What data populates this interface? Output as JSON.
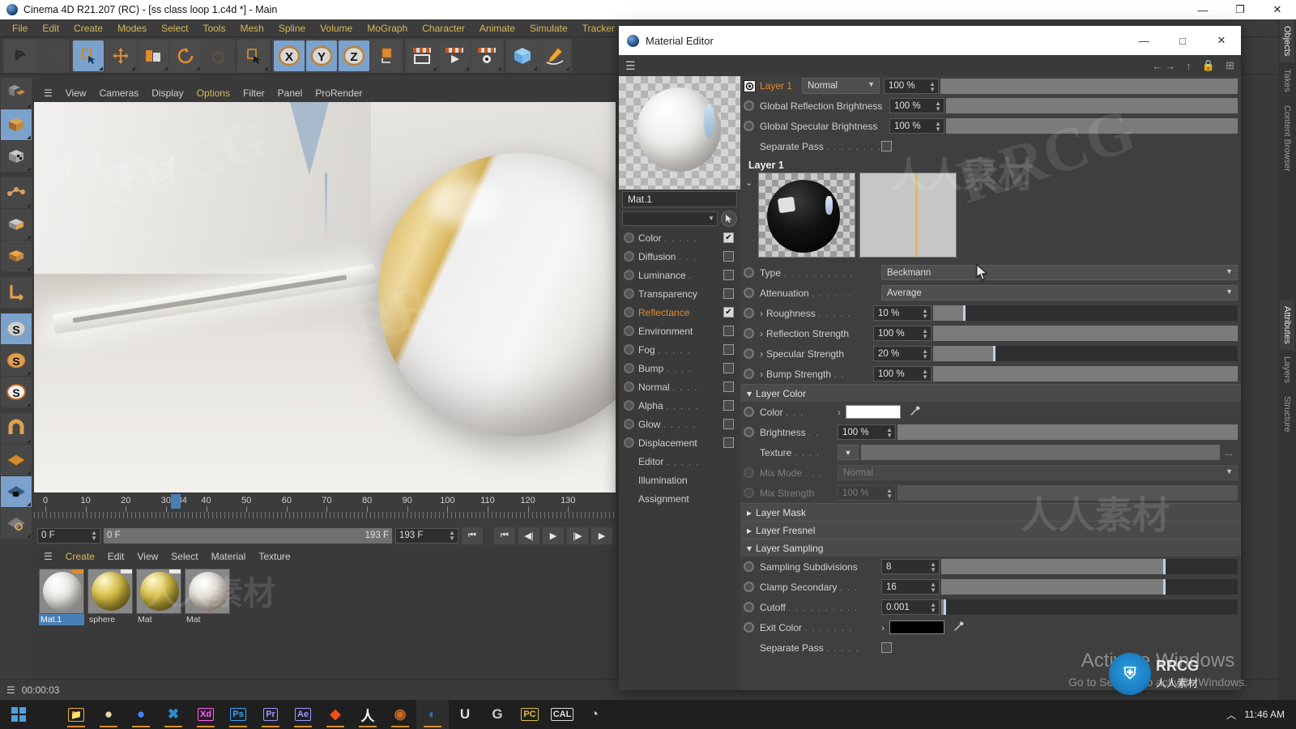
{
  "window": {
    "title": "Cinema 4D R21.207 (RC) - [ss class loop 1.c4d *] - Main",
    "minimize": "—",
    "restore": "❐",
    "close": "✕"
  },
  "menubar": [
    "File",
    "Edit",
    "Create",
    "Modes",
    "Select",
    "Tools",
    "Mesh",
    "Spline",
    "Volume",
    "MoGraph",
    "Character",
    "Animate",
    "Simulate",
    "Tracker"
  ],
  "toolbar_icons": [
    {
      "name": "undo-icon",
      "glyph": "↺"
    },
    {
      "name": "redo-icon",
      "glyph": "↻"
    },
    {
      "name": "select-tool-icon",
      "glyph": "▣"
    },
    {
      "name": "move-tool-icon",
      "glyph": "✛"
    },
    {
      "name": "scale-tool-icon",
      "glyph": "▤"
    },
    {
      "name": "rotate-tool-icon",
      "glyph": "⟳"
    },
    {
      "name": "rotate-disabled-icon",
      "glyph": "⭕"
    },
    {
      "name": "world-object-axis-icon",
      "glyph": "▢"
    },
    {
      "name": "axis-x-icon",
      "glyph": "X"
    },
    {
      "name": "axis-y-icon",
      "glyph": "Y"
    },
    {
      "name": "axis-z-icon",
      "glyph": "Z"
    },
    {
      "name": "world-coordinate-icon",
      "glyph": "⬛"
    },
    {
      "name": "render-view-icon",
      "glyph": "▭"
    },
    {
      "name": "render-to-picture-viewer-icon",
      "glyph": "▶"
    },
    {
      "name": "render-settings-icon",
      "glyph": "⚙"
    },
    {
      "name": "cube-primitive-icon",
      "glyph": "⬛"
    },
    {
      "name": "spline-pen-icon",
      "glyph": "✎"
    }
  ],
  "left_toolbar": [
    {
      "name": "make-editable-icon",
      "glyph": "⬓"
    },
    {
      "name": "model-mode-icon",
      "glyph": "▥"
    },
    {
      "name": "texture-mode-icon",
      "glyph": "▦"
    },
    {
      "name": "point-mode-icon",
      "glyph": "⬡"
    },
    {
      "name": "edge-mode-icon",
      "glyph": "▤"
    },
    {
      "name": "polygon-mode-icon",
      "glyph": "▧"
    },
    {
      "name": "axis-modify-icon",
      "glyph": "∟"
    },
    {
      "name": "enable-axis-icon",
      "glyph": "S"
    },
    {
      "name": "enable-snap-icon",
      "glyph": "S"
    },
    {
      "name": "workplane-icon",
      "glyph": "S"
    },
    {
      "name": "magnet-icon",
      "glyph": "U"
    },
    {
      "name": "grid-icon",
      "glyph": "◈"
    },
    {
      "name": "workplane-lock-icon",
      "glyph": "◈"
    },
    {
      "name": "workplane-rotate-icon",
      "glyph": "◈"
    }
  ],
  "viewport": {
    "menu": [
      "View",
      "Cameras",
      "Display",
      "Options",
      "Filter",
      "Panel",
      "ProRender"
    ],
    "highlight": "Options"
  },
  "timeline": {
    "labels": [
      "0",
      "10",
      "20",
      "30",
      "34",
      "40",
      "50",
      "60",
      "70",
      "80",
      "90",
      "100",
      "110",
      "120",
      "130"
    ],
    "current_frame_label": "34",
    "start_field": "0 F",
    "range_left": "0 F",
    "range_right": "193 F",
    "end_field": "193 F",
    "transport": [
      "⏮",
      "⏮",
      "◀|",
      "▶",
      "|▶",
      "▶"
    ]
  },
  "material_manager": {
    "menu": [
      "Create",
      "Edit",
      "View",
      "Select",
      "Material",
      "Texture"
    ],
    "highlight": "Create",
    "materials": [
      {
        "name": "Mat.1",
        "selected": true,
        "tag": "orange"
      },
      {
        "name": "sphere",
        "selected": false,
        "tag": "white"
      },
      {
        "name": "Mat",
        "selected": false,
        "tag": "white"
      },
      {
        "name": "Mat",
        "selected": false,
        "tag": "none"
      }
    ]
  },
  "statusbar": {
    "time": "00:00:03"
  },
  "right_tabs": [
    {
      "label": "Objects",
      "active": true
    },
    {
      "label": "Takes",
      "active": false
    },
    {
      "label": "Content Browser",
      "active": false
    },
    {
      "label": "Attributes",
      "active": true
    },
    {
      "label": "Layers",
      "active": false
    },
    {
      "label": "Structure",
      "active": false
    }
  ],
  "material_editor": {
    "title": "Material Editor",
    "window_controls": {
      "minimize": "—",
      "maximize": "□",
      "close": "✕"
    },
    "nav_icons": [
      "←",
      "→",
      "↑",
      "🔒",
      "⊞"
    ],
    "material_name": "Mat.1",
    "channels": [
      {
        "label": "Color",
        "dots": ". . . . .",
        "checked": true,
        "active": false
      },
      {
        "label": "Diffusion",
        "dots": ". . .",
        "checked": false,
        "active": false
      },
      {
        "label": "Luminance",
        "dots": ".",
        "checked": false,
        "active": false
      },
      {
        "label": "Transparency",
        "dots": "",
        "checked": false,
        "active": false
      },
      {
        "label": "Reflectance",
        "dots": "",
        "checked": true,
        "active": true
      },
      {
        "label": "Environment",
        "dots": "",
        "checked": false,
        "active": false
      },
      {
        "label": "Fog",
        "dots": ". . . . .",
        "checked": false,
        "active": false
      },
      {
        "label": "Bump",
        "dots": ". . . .",
        "checked": false,
        "active": false
      },
      {
        "label": "Normal",
        "dots": ". . . .",
        "checked": false,
        "active": false
      },
      {
        "label": "Alpha",
        "dots": ". . . . .",
        "checked": false,
        "active": false
      },
      {
        "label": "Glow",
        "dots": ". . . . .",
        "checked": false,
        "active": false
      },
      {
        "label": "Displacement",
        "dots": "",
        "checked": false,
        "active": false
      }
    ],
    "sub_items": [
      {
        "label": "Editor",
        "dots": ". . . . ."
      },
      {
        "label": "Illumination",
        "dots": ""
      },
      {
        "label": "Assignment",
        "dots": ""
      }
    ],
    "layer_header": {
      "name": "Layer 1",
      "blend_mode": "Normal",
      "opacity": "100 %"
    },
    "globals": [
      {
        "label": "Global Reflection Brightness",
        "value": "100 %",
        "fill": 100
      },
      {
        "label": "Global Specular Brightness",
        "value": "100 %",
        "fill": 100
      }
    ],
    "separate_pass_top": {
      "label": "Separate Pass",
      "dots": ". . . . . . . . ."
    },
    "layer_section": {
      "title": "Layer 1"
    },
    "type_row": {
      "label": "Type",
      "dots": ". . . . . . . . . .",
      "value": "Beckmann"
    },
    "attenuation_row": {
      "label": "Attenuation",
      "dots": ". . . . . .",
      "value": "Average"
    },
    "params": [
      {
        "label": "Roughness",
        "dots": ". . . . .",
        "value": "10 %",
        "fill": 10,
        "arrow": "›"
      },
      {
        "label": "Reflection Strength",
        "dots": "",
        "value": "100 %",
        "fill": 100,
        "arrow": "›"
      },
      {
        "label": "Specular Strength",
        "dots": "",
        "value": "20 %",
        "fill": 20,
        "arrow": "›"
      },
      {
        "label": "Bump Strength",
        "dots": ". .",
        "value": "100 %",
        "fill": 100,
        "arrow": "›"
      }
    ],
    "layer_color": {
      "title": "Layer Color",
      "color_label": "Color",
      "color_dots": ". . .",
      "color_hex": "#ffffff",
      "brightness_label": "Brightness",
      "brightness_dots": ". .",
      "brightness_value": "100 %",
      "brightness_fill": 100,
      "texture_label": "Texture",
      "texture_dots": ". . . .",
      "texture_value": "",
      "texture_more": "...",
      "mix_mode_label": "Mix Mode",
      "mix_mode_dots": ". . .",
      "mix_mode_value": "Normal",
      "mix_strength_label": "Mix Strength",
      "mix_strength_dots": "",
      "mix_strength_value": "100 %"
    },
    "collapsed_sections": [
      {
        "title": "Layer Mask",
        "arrow": "▸"
      },
      {
        "title": "Layer Fresnel",
        "arrow": "▸"
      }
    ],
    "layer_sampling": {
      "title": "Layer Sampling",
      "rows": [
        {
          "label": "Sampling Subdivisions",
          "dots": "",
          "value": "8",
          "fill": 75
        },
        {
          "label": "Clamp Secondary",
          "dots": ". . .",
          "value": "16",
          "fill": 75
        },
        {
          "label": "Cutoff",
          "dots": ". . . . . . . . . .",
          "value": "0.001",
          "fill": 1
        }
      ],
      "exit_color": {
        "label": "Exit Color",
        "dots": ". . . . . . .",
        "hex": "#000000"
      },
      "separate_pass": {
        "label": "Separate Pass",
        "dots": ". . . . ."
      }
    }
  },
  "activate_windows": {
    "line1": "Activate Windows",
    "line2": "Go to Settings to activate Windows."
  },
  "taskbar": {
    "start_icon": "⊞",
    "apps": [
      {
        "name": "file-explorer-icon",
        "glyph": "📁",
        "color": "#f0b429"
      },
      {
        "name": "opera-icon",
        "glyph": "●",
        "color": "#e8d5a0"
      },
      {
        "name": "chrome-icon",
        "glyph": "●",
        "color": "#4285f4"
      },
      {
        "name": "vscode-icon",
        "glyph": "✖",
        "color": "#2f8ccc"
      },
      {
        "name": "adobe-xd-icon",
        "glyph": "Xd",
        "color": "#ff61f6"
      },
      {
        "name": "photoshop-icon",
        "glyph": "Ps",
        "color": "#31a8ff"
      },
      {
        "name": "premiere-icon",
        "glyph": "Pr",
        "color": "#9999ff"
      },
      {
        "name": "after-effects-icon",
        "glyph": "Ae",
        "color": "#9999ff"
      },
      {
        "name": "figma-icon",
        "glyph": "◆",
        "color": "#f24e1e"
      },
      {
        "name": "houdini-icon",
        "glyph": "人",
        "color": "#ffffff"
      },
      {
        "name": "davinci-resolve-icon",
        "glyph": "◉",
        "color": "#cc6622"
      },
      {
        "name": "cinema4d-icon",
        "glyph": "◐",
        "color": "#2a6fb5"
      },
      {
        "name": "unreal-engine-icon",
        "glyph": "U",
        "color": "#dddddd"
      },
      {
        "name": "substance-icon",
        "glyph": "G",
        "color": "#cccccc"
      },
      {
        "name": "pc-icon",
        "glyph": "PC",
        "color": "#e0c040"
      },
      {
        "name": "cal-icon",
        "glyph": "CAL",
        "color": "#dddddd"
      },
      {
        "name": "clock-app-icon",
        "glyph": "◔",
        "color": "#cccccc"
      }
    ],
    "tray_chevron": "︿",
    "clock": "11:46 AM"
  },
  "watermarks": {
    "rrcg": "RRCG",
    "cn": "人人素材"
  }
}
